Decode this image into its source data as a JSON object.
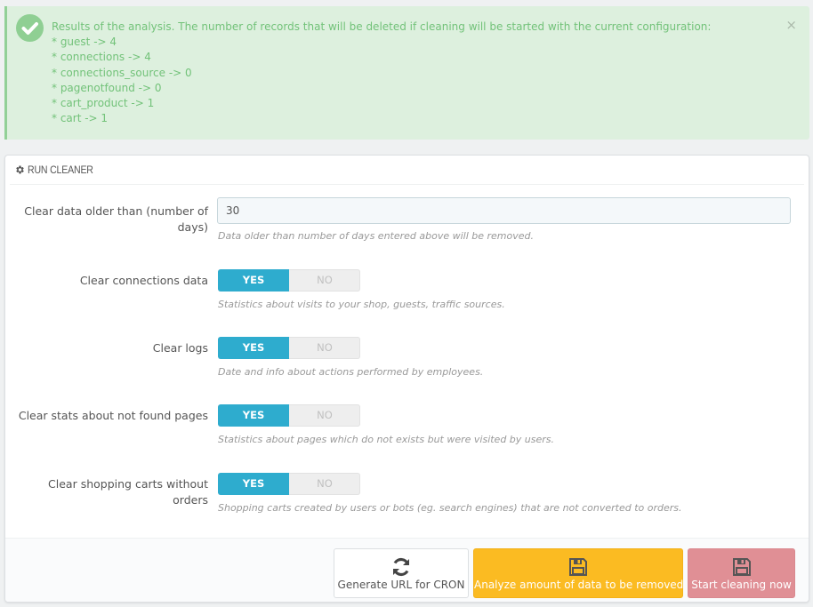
{
  "alert": {
    "type": "success",
    "icon": "check-circle-icon",
    "heading": "Results of the analysis. The number of records that will be deleted if cleaning will be started with the current configuration:",
    "results": [
      "* guest -> 4",
      "* connections -> 4",
      "* connections_source -> 0",
      "* pagenotfound -> 0",
      "* cart_product -> 1",
      "* cart -> 1"
    ],
    "close_label": "×"
  },
  "panel": {
    "title": "RUN CLEANER",
    "title_icon": "gear-icon",
    "days_field": {
      "label": "Clear data older than (number of days)",
      "value": "30",
      "help": "Data older than number of days entered above will be removed."
    },
    "switches": [
      {
        "label": "Clear connections data",
        "yes_label": "YES",
        "no_label": "NO",
        "value": "YES",
        "help": "Statistics about visits to your shop, guests, traffic sources."
      },
      {
        "label": "Clear logs",
        "yes_label": "YES",
        "no_label": "NO",
        "value": "YES",
        "help": "Date and info about actions performed by employees."
      },
      {
        "label": "Clear stats about not found pages",
        "yes_label": "YES",
        "no_label": "NO",
        "value": "YES",
        "help": "Statistics about pages which do not exists but were visited by users."
      },
      {
        "label": "Clear shopping carts without orders",
        "yes_label": "YES",
        "no_label": "NO",
        "value": "YES",
        "help": "Shopping carts created by users or bots (eg. search engines) that are not converted to orders."
      }
    ],
    "footer": {
      "buttons": [
        {
          "label": "Generate URL for CRON",
          "icon": "refresh-icon"
        },
        {
          "label": "Analyze amount of data to be removed",
          "icon": "save-icon"
        },
        {
          "label": "Start cleaning now",
          "icon": "save-icon"
        }
      ]
    }
  },
  "colors": {
    "success_bg": "#ddf0de",
    "success_text": "#72c279",
    "switch_on": "#2eacce",
    "warning": "#fbbb22",
    "danger": "#e08f95"
  }
}
